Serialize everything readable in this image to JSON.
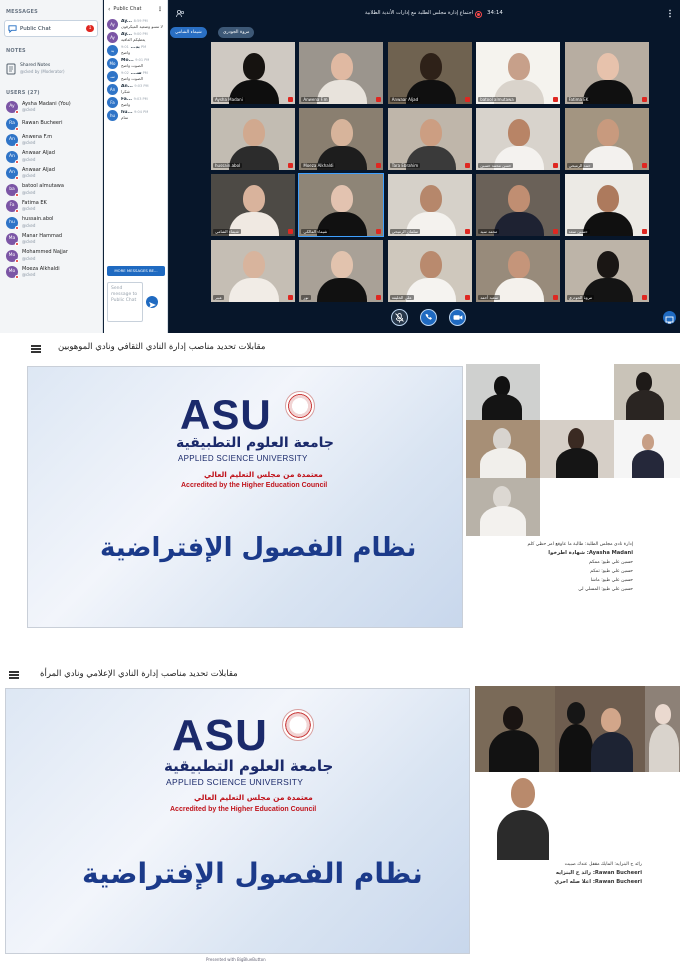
{
  "conference": {
    "sidebar": {
      "messages_heading": "MESSAGES",
      "public_chat": {
        "label": "Public Chat",
        "badge": "1"
      },
      "notes_heading": "NOTES",
      "shared_notes": {
        "label": "Shared Notes",
        "sub": "@cked by (Moderator)"
      },
      "users_heading": "USERS (27)",
      "users": [
        {
          "initials": "Ay",
          "name": "Aysha Madani (You)",
          "sub": "@cked",
          "color": "#7b55a5"
        },
        {
          "initials": "Ra",
          "name": "Rawan Bucheeri",
          "sub": "",
          "color": "#2f74c7"
        },
        {
          "initials": "An",
          "name": "Anwena F.m",
          "sub": "@cked",
          "color": "#2f74c7"
        },
        {
          "initials": "An",
          "name": "Anwaar Aljad",
          "sub": "@cked",
          "color": "#2f74c7"
        },
        {
          "initials": "An",
          "name": "Anwaar Aljad",
          "sub": "@cked",
          "color": "#2f74c7"
        },
        {
          "initials": "ba",
          "name": "batool almutawa",
          "sub": "@cked",
          "color": "#7b55a5"
        },
        {
          "initials": "Fa",
          "name": "Fatima EK",
          "sub": "@cked",
          "color": "#7b55a5"
        },
        {
          "initials": "hu",
          "name": "hussain.abol",
          "sub": "@cked",
          "color": "#2f74c7"
        },
        {
          "initials": "Ma",
          "name": "Manar Hammad",
          "sub": "@cked",
          "color": "#7b55a5"
        },
        {
          "initials": "Mo",
          "name": "Mohammed Najjar",
          "sub": "@cked",
          "color": "#7b55a5"
        },
        {
          "initials": "Mo",
          "name": "Moeza Alkhaldi",
          "sub": "@cked",
          "color": "#7b55a5"
        }
      ]
    },
    "chat": {
      "back_label": "Public Chat",
      "messages": [
        {
          "initials": "Ay",
          "name": "Ay...",
          "time": "8:59 PM",
          "text": "لا تنسو وضعية الميكرفون",
          "color": "#7b55a5"
        },
        {
          "initials": "Ay",
          "name": "Ay...",
          "time": "9:00 PM",
          "text": "يعطيكم العافية",
          "color": "#7b55a5"
        },
        {
          "initials": "بد",
          "name": "بد...",
          "time": "9:01 PM",
          "text": "واضح",
          "color": "#2f74c7"
        },
        {
          "initials": "Mo",
          "name": "Mo...",
          "time": "9:01 PM",
          "text": "الصوت واضح",
          "color": "#2f74c7"
        },
        {
          "initials": "سـ",
          "name": "سـ...",
          "time": "9:02 PM",
          "text": "الصوت واضح",
          "color": "#2f74c7"
        },
        {
          "initials": "An",
          "name": "An...",
          "time": "9:03 PM",
          "text": "شكرا",
          "color": "#2f74c7"
        },
        {
          "initials": "Fa",
          "name": "Fa...",
          "time": "9:03 PM",
          "text": "واضح",
          "color": "#2f74c7"
        },
        {
          "initials": "hu",
          "name": "hu...",
          "time": "9:04 PM",
          "text": "تمام",
          "color": "#2f74c7"
        }
      ],
      "more_messages": "MORE MESSAGES BE...",
      "send_placeholder": "Send message to Public Chat"
    },
    "topbar": {
      "title": "اجتماع إدارة مجلس الطلبة مع إدارات الأندية الطلابية",
      "timer": "34:14"
    },
    "chips": [
      "شيماء الشامي",
      "مروة الجودري"
    ],
    "participants": [
      "Aysha Madani",
      "Anwena F.m",
      "Anwaar Aljad",
      "batool almutawa",
      "Fatima EK",
      "hussain.abol",
      "Moeza Alkhaldi",
      "Tara Ebrahim",
      "حسن محمد حسين",
      "حمد الرميحي",
      "شيماء الشامي",
      "شيماء المالكي",
      "سلمان الرميحي",
      "محمد سيد",
      "حسين سعد",
      "عبير",
      "نور",
      "علي الخليفة",
      "سعيد أحمد",
      "مروة الجودري"
    ]
  },
  "session_cultural": {
    "title": "مقابلات تحديد مناصب إدارة النادي الثقافي ونادي الموهوبين",
    "slide": {
      "brand": "ASU",
      "name_ar": "جامعة العلوم التطبيقية",
      "name_en": "APPLIED SCIENCE UNIVERSITY",
      "accredited_ar": "معتمدة من مجلس التعليم العالي",
      "accredited_en": "Accredited by the Higher Education Council",
      "system_ar": "نظام الفصول الإفتراضية"
    },
    "list": [
      "إدارة نادي مجلس الطلبة: طالبة ما عاوقع امر حظي كلم",
      "Ayasha Madani: شهادة اطرخوا",
      "حسين علي طيو: ممكم",
      "حسين علي طيو: تمكم",
      "حسين علي طيو: ماشا",
      "حسين علي طيو: المسلي لي"
    ]
  },
  "session_media": {
    "title": "مقابلات تحديد مناصب إدارة النادي الإعلامي ونادي المرأة",
    "slide": {
      "brand": "ASU",
      "name_ar": "جامعة العلوم التطبيقية",
      "name_en": "APPLIED SCIENCE UNIVERSITY",
      "accredited_ar": "معتمدة من مجلس التعليم العالي",
      "accredited_en": "Accredited by the Higher Education Council",
      "system_ar": "نظام الفصول الإفتراضية"
    },
    "list": [
      "رائد ح البنزايه: المايك مقفل عندك صبيت",
      "Rawan Bucheeri: رائد ح البنزايه",
      "Rawan Bucheeri: اعلا صله احري"
    ],
    "footer": "Presented with BigBlueButton"
  }
}
